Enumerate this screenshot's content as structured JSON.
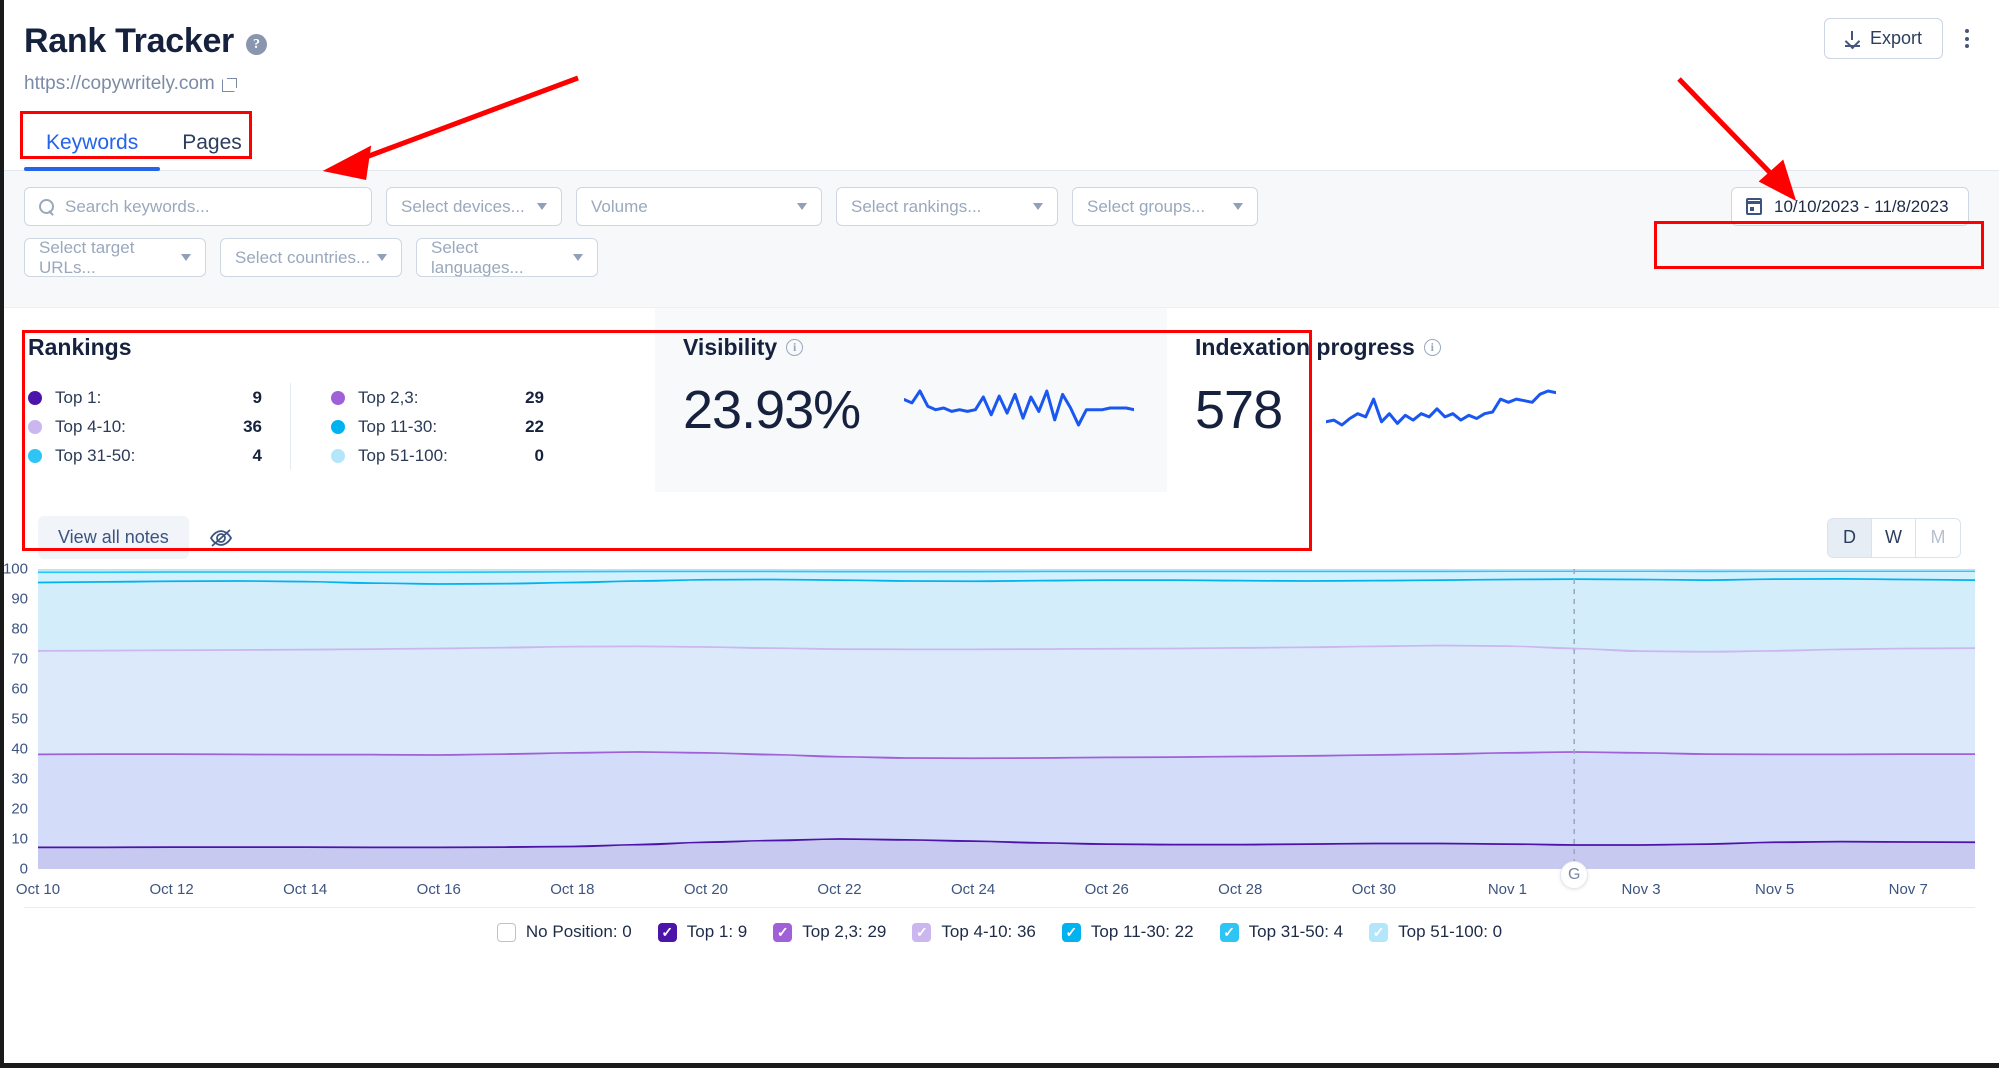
{
  "header": {
    "title": "Rank Tracker",
    "help_icon": "help-circle-icon",
    "site_url": "https://copywritely.com",
    "export_label": "Export",
    "kebab_icon": "more-vertical-icon"
  },
  "tabs": [
    {
      "label": "Keywords",
      "active": true
    },
    {
      "label": "Pages",
      "active": false
    }
  ],
  "filters": {
    "search_placeholder": "Search keywords...",
    "devices": "Select devices...",
    "volume": "Volume",
    "rankings": "Select rankings...",
    "groups": "Select groups...",
    "target_urls": "Select target URLs...",
    "countries": "Select countries...",
    "languages": "Select languages...",
    "date_range": "10/10/2023 - 11/8/2023"
  },
  "rankings_card": {
    "title": "Rankings",
    "left": [
      {
        "label": "Top 1:",
        "value": "9",
        "color": "#4c14a8"
      },
      {
        "label": "Top 4-10:",
        "value": "36",
        "color": "#cbb6f0"
      },
      {
        "label": "Top 31-50:",
        "value": "4",
        "color": "#2ec4f5"
      }
    ],
    "right": [
      {
        "label": "Top 2,3:",
        "value": "29",
        "color": "#a060d8"
      },
      {
        "label": "Top 11-30:",
        "value": "22",
        "color": "#00b3f0"
      },
      {
        "label": "Top 51-100:",
        "value": "0",
        "color": "#b3e6fb"
      }
    ]
  },
  "visibility_card": {
    "title": "Visibility",
    "info_icon": "info-icon",
    "value": "23.93%"
  },
  "indexation_card": {
    "title": "Indexation progress",
    "info_icon": "info-icon",
    "value": "578"
  },
  "chart_toolbar": {
    "view_all_notes": "View all notes",
    "hide_notes_icon": "eye-off-icon",
    "granularity": [
      {
        "label": "D",
        "state": "selected"
      },
      {
        "label": "W",
        "state": "default"
      },
      {
        "label": "M",
        "state": "dimmed"
      }
    ]
  },
  "chart_annotation": {
    "marker_label": "G",
    "x_date": "Nov 2"
  },
  "legend": [
    {
      "label": "No Position: 0",
      "checked": false,
      "color": "#ffffff"
    },
    {
      "label": "Top 1: 9",
      "checked": true,
      "color": "#4c14a8"
    },
    {
      "label": "Top 2,3: 29",
      "checked": true,
      "color": "#a060d8"
    },
    {
      "label": "Top 4-10: 36",
      "checked": true,
      "color": "#cbb6f0"
    },
    {
      "label": "Top 11-30: 22",
      "checked": true,
      "color": "#00b3f0"
    },
    {
      "label": "Top 31-50: 4",
      "checked": true,
      "color": "#2ec4f5"
    },
    {
      "label": "Top 51-100: 0",
      "checked": true,
      "color": "#b3e6fb"
    }
  ],
  "chart_data": {
    "type": "area",
    "title": "",
    "xlabel": "",
    "ylabel": "",
    "ylim": [
      0,
      100
    ],
    "yticks": [
      0,
      10,
      20,
      30,
      40,
      50,
      60,
      70,
      80,
      90,
      100
    ],
    "grid": true,
    "legend_position": "bottom",
    "stacked": true,
    "x": [
      "Oct 10",
      "Oct 11",
      "Oct 12",
      "Oct 13",
      "Oct 14",
      "Oct 15",
      "Oct 16",
      "Oct 17",
      "Oct 18",
      "Oct 19",
      "Oct 20",
      "Oct 21",
      "Oct 22",
      "Oct 23",
      "Oct 24",
      "Oct 25",
      "Oct 26",
      "Oct 27",
      "Oct 28",
      "Oct 29",
      "Oct 30",
      "Oct 31",
      "Nov 1",
      "Nov 2",
      "Nov 3",
      "Nov 4",
      "Nov 5",
      "Nov 6",
      "Nov 7",
      "Nov 8"
    ],
    "xticks": [
      "Oct 10",
      "Oct 12",
      "Oct 14",
      "Oct 16",
      "Oct 18",
      "Oct 20",
      "Oct 22",
      "Oct 24",
      "Oct 26",
      "Oct 28",
      "Oct 30",
      "Nov 1",
      "Nov 3",
      "Nov 5",
      "Nov 7"
    ],
    "series": [
      {
        "name": "Top 1",
        "color": "#4c14a8",
        "cum": [
          7.5,
          7.5,
          7.6,
          7.6,
          7.6,
          7.5,
          7.5,
          7.6,
          7.8,
          8.4,
          9.2,
          9.8,
          10.3,
          10.0,
          9.6,
          9.0,
          8.6,
          8.4,
          8.4,
          8.6,
          8.8,
          8.8,
          8.6,
          8.3,
          8.3,
          8.6,
          9.2,
          9.4,
          9.3,
          9.2
        ]
      },
      {
        "name": "Top 2,3",
        "color": "#a060d8",
        "cum": [
          38.5,
          38.6,
          38.6,
          38.5,
          38.4,
          38.4,
          38.3,
          38.6,
          39.0,
          39.3,
          39.0,
          38.4,
          37.7,
          37.3,
          37.2,
          37.3,
          37.5,
          37.6,
          37.8,
          38.0,
          38.3,
          38.6,
          39.0,
          39.3,
          39.0,
          38.6,
          38.5,
          38.5,
          38.6,
          38.6
        ]
      },
      {
        "name": "Top 4-10",
        "color": "#cbb6f0",
        "cum": [
          73.0,
          73.1,
          73.2,
          73.3,
          73.4,
          73.6,
          73.8,
          74.1,
          74.4,
          74.5,
          74.3,
          73.9,
          73.6,
          73.5,
          73.5,
          73.6,
          73.7,
          73.8,
          74.0,
          74.2,
          74.5,
          74.8,
          74.6,
          73.8,
          72.9,
          72.7,
          73.0,
          73.5,
          73.8,
          73.9
        ]
      },
      {
        "name": "Top 11-30",
        "color": "#00b3f0",
        "cum": [
          95.8,
          96.0,
          96.2,
          96.3,
          96.1,
          95.6,
          95.3,
          95.4,
          95.8,
          96.3,
          96.7,
          96.8,
          96.6,
          96.3,
          96.2,
          96.4,
          96.6,
          96.6,
          96.4,
          96.3,
          96.4,
          96.6,
          96.8,
          96.9,
          96.8,
          96.6,
          96.9,
          97.0,
          96.8,
          96.6
        ]
      },
      {
        "name": "Top 31-50",
        "color": "#2ec4f5",
        "cum": [
          99.2,
          99.2,
          99.3,
          99.3,
          99.3,
          99.2,
          99.2,
          99.3,
          99.4,
          99.5,
          99.5,
          99.5,
          99.4,
          99.4,
          99.4,
          99.5,
          99.5,
          99.5,
          99.5,
          99.5,
          99.5,
          99.5,
          99.6,
          99.6,
          99.6,
          99.5,
          99.6,
          99.6,
          99.6,
          99.6
        ]
      },
      {
        "name": "Top 51-100",
        "color": "#b3e6fb",
        "cum": [
          100,
          100,
          100,
          100,
          100,
          100,
          100,
          100,
          100,
          100,
          100,
          100,
          100,
          100,
          100,
          100,
          100,
          100,
          100,
          100,
          100,
          100,
          100,
          100,
          100,
          100,
          100,
          100,
          100,
          100
        ]
      }
    ],
    "sparklines": {
      "visibility": [
        52,
        48,
        62,
        44,
        40,
        42,
        38,
        40,
        38,
        40,
        55,
        34,
        56,
        36,
        58,
        30,
        55,
        38,
        62,
        28,
        58,
        42,
        22,
        40,
        40,
        40,
        42,
        42,
        42,
        40
      ],
      "indexation": [
        24,
        26,
        20,
        28,
        34,
        30,
        52,
        24,
        34,
        22,
        32,
        26,
        34,
        30,
        40,
        30,
        34,
        26,
        32,
        28,
        34,
        36,
        52,
        48,
        52,
        50,
        48,
        58,
        62,
        60
      ]
    }
  }
}
